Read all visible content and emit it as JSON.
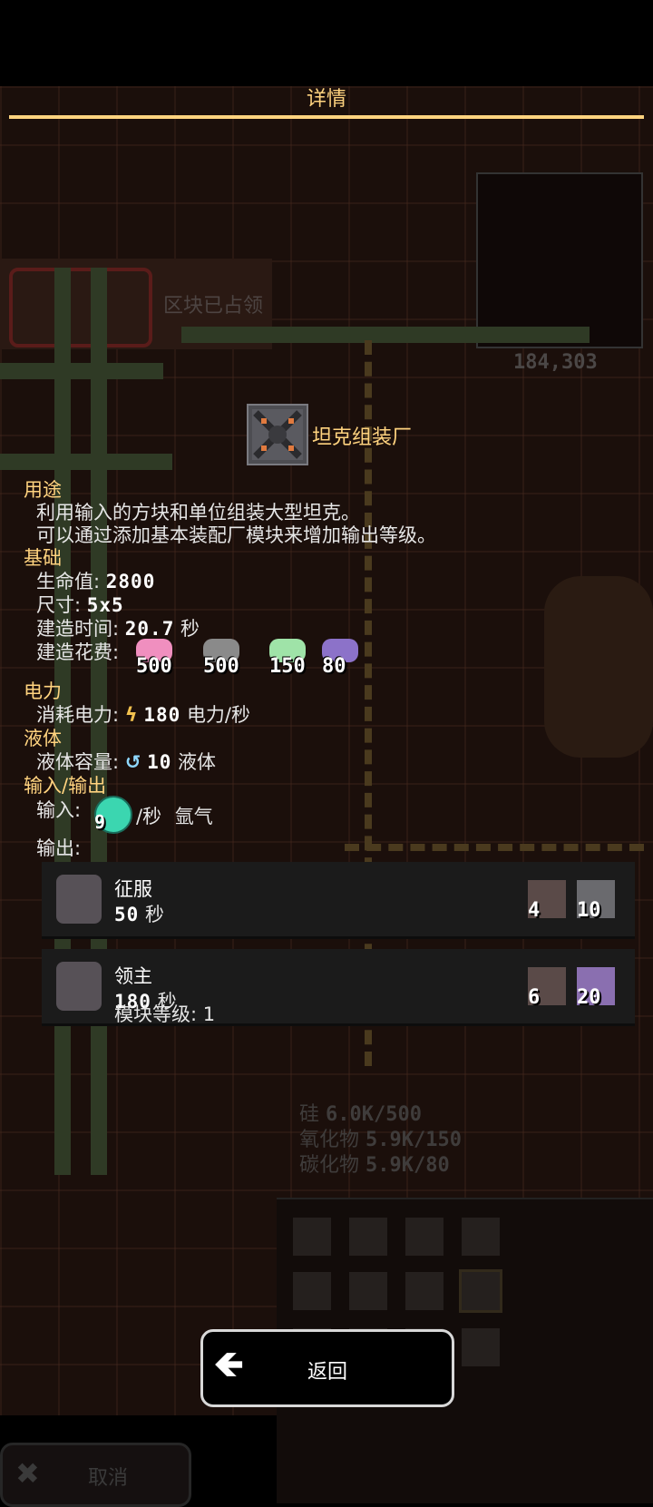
{
  "title": "详情",
  "background": {
    "sector_status": "区块已占领",
    "coordinates": "184,303",
    "resources": [
      {
        "name": "硅",
        "value": "6.0K/500"
      },
      {
        "name": "氧化物",
        "value": "5.9K/150"
      },
      {
        "name": "碳化物",
        "value": "5.9K/80"
      }
    ],
    "cancel_label": "取消"
  },
  "block": {
    "name": "坦克组装厂",
    "icon": "tank-assembler-icon"
  },
  "usage": {
    "heading": "用途",
    "line1": "利用输入的方块和单位组装大型坦克。",
    "line2": "可以通过添加基本装配厂模块来增加输出等级。"
  },
  "general": {
    "heading": "基础",
    "health_label": "生命值:",
    "health_value": "2800",
    "size_label": "尺寸:",
    "size_value": "5x5",
    "build_time_label": "建造时间:",
    "build_time_value": "20.7",
    "build_time_unit": "秒",
    "build_cost_label": "建造花费:",
    "costs": [
      {
        "icon": "pink-material-icon",
        "amount": "500",
        "color": "#f08fbf"
      },
      {
        "icon": "gray-material-icon",
        "amount": "500",
        "color": "#8a8a8a"
      },
      {
        "icon": "green-material-icon",
        "amount": "150",
        "color": "#9fe3a8"
      },
      {
        "icon": "purple-material-icon",
        "amount": "80",
        "color": "#8c72c9"
      }
    ]
  },
  "power": {
    "heading": "电力",
    "label": "消耗电力:",
    "value": "180",
    "unit": "电力/秒"
  },
  "liquid": {
    "heading": "液体",
    "label": "液体容量:",
    "value": "10",
    "unit": "液体"
  },
  "io": {
    "heading": "输入/输出",
    "input_label": "输入:",
    "input_amount": "9",
    "input_rate": "/秒",
    "input_name": "氩气",
    "output_label": "输出:"
  },
  "outputs": [
    {
      "name": "征服",
      "time": "50",
      "time_unit": "秒",
      "req1": "4",
      "req2": "10"
    },
    {
      "name": "领主",
      "time": "180",
      "time_unit": "秒",
      "level_label": "模块等级:",
      "level_value": "1",
      "req1": "6",
      "req2": "20"
    }
  ],
  "back_label": "返回"
}
